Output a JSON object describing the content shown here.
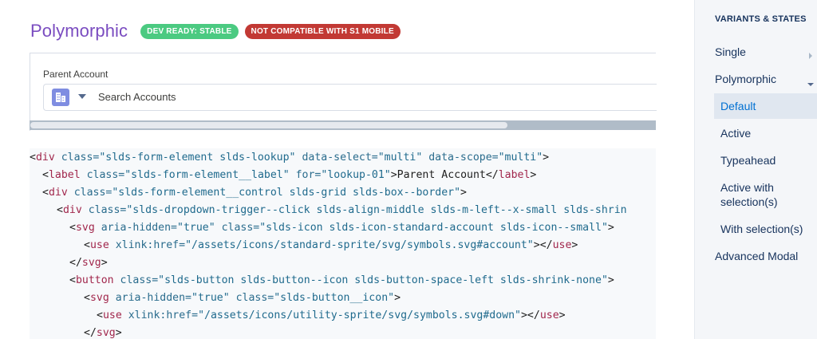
{
  "header": {
    "title": "Polymorphic",
    "badges": [
      {
        "label": "DEV READY: STABLE",
        "color": "#4bca81"
      },
      {
        "label": "NOT COMPATIBLE WITH S1 MOBILE",
        "color": "#c23934"
      }
    ]
  },
  "preview": {
    "field_label": "Parent Account",
    "icon": "account-icon",
    "dropdown_icon": "chevron-down-icon",
    "search_text": "Search Accounts"
  },
  "code": {
    "lines": [
      [
        "<",
        "div",
        " class=",
        "\"slds-form-element slds-lookup\"",
        " data-select=",
        "\"multi\"",
        " data-scope=",
        "\"multi\"",
        ">"
      ],
      [
        "<",
        "label",
        " class=",
        "\"slds-form-element__label\"",
        " for=",
        "\"lookup-01\"",
        ">",
        "Parent Account",
        "</",
        "label",
        ">"
      ],
      [
        "<",
        "div",
        " class=",
        "\"slds-form-element__control slds-grid slds-box--border\"",
        ">"
      ],
      [
        "<",
        "div",
        " class=",
        "\"slds-dropdown-trigger--click slds-align-middle slds-m-left--x-small slds-shrin"
      ],
      [
        "<",
        "svg",
        " aria-hidden=",
        "\"true\"",
        " class=",
        "\"slds-icon slds-icon-standard-account slds-icon--small\"",
        ">"
      ],
      [
        "<",
        "use",
        " xlink:href=",
        "\"/assets/icons/standard-sprite/svg/symbols.svg#account\"",
        "></",
        "use",
        ">"
      ],
      [
        "</",
        "svg",
        ">"
      ],
      [
        "<",
        "button",
        " class=",
        "\"slds-button slds-button--icon slds-button-space-left slds-shrink-none\"",
        ">"
      ],
      [
        "<",
        "svg",
        " aria-hidden=",
        "\"true\"",
        " class=",
        "\"slds-button__icon\"",
        ">"
      ],
      [
        "<",
        "use",
        " xlink:href=",
        "\"/assets/icons/utility-sprite/svg/symbols.svg#down\"",
        "></",
        "use",
        ">"
      ],
      [
        "</",
        "svg",
        ">"
      ]
    ]
  },
  "sidebar": {
    "heading": "VARIANTS & STATES",
    "items": [
      {
        "label": "Single",
        "level": "top",
        "expander": "chevron-right-icon"
      },
      {
        "label": "Polymorphic",
        "level": "top",
        "expander": "chevron-down-icon"
      },
      {
        "label": "Default",
        "level": "sub",
        "active": true
      },
      {
        "label": "Active",
        "level": "sub"
      },
      {
        "label": "Typeahead",
        "level": "sub"
      },
      {
        "label": "Active with selection(s)",
        "level": "sub"
      },
      {
        "label": "With selection(s)",
        "level": "sub"
      },
      {
        "label": "Advanced Modal",
        "level": "top"
      }
    ]
  },
  "colors": {
    "title": "#7a4cc0",
    "active_link": "#0070d2",
    "tag": "#a1274c",
    "attr": "#2a6c8d"
  }
}
